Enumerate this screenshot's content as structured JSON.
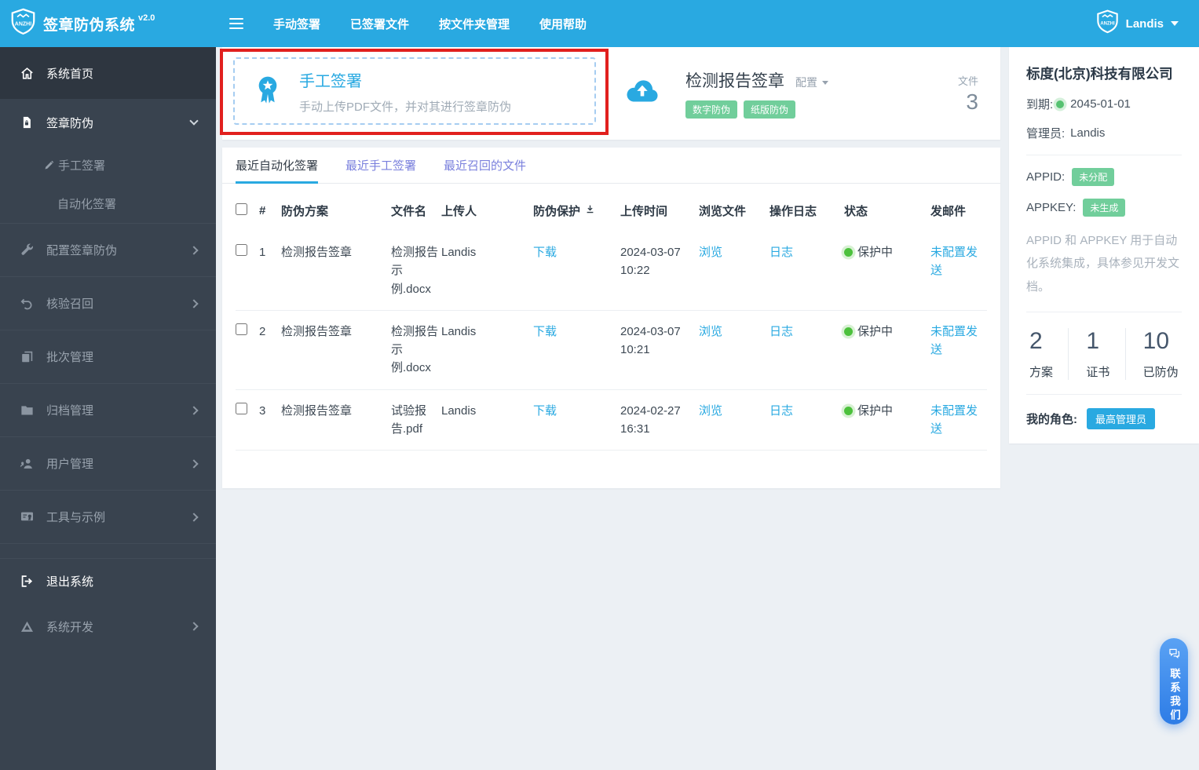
{
  "topbar": {
    "brand": "签章防伪系统",
    "version": "v2.0",
    "nav": [
      {
        "label": "手动签署"
      },
      {
        "label": "已签署文件"
      },
      {
        "label": "按文件夹管理"
      },
      {
        "label": "使用帮助"
      }
    ],
    "user": {
      "name": "Landis"
    }
  },
  "sidebar": {
    "items": [
      {
        "label": "系统首页"
      },
      {
        "label": "签章防伪",
        "expanded": true,
        "children": [
          {
            "label": "手工签署"
          },
          {
            "label": "自动化签署"
          }
        ]
      },
      {
        "label": "配置签章防伪"
      },
      {
        "label": "核验召回"
      },
      {
        "label": "批次管理"
      },
      {
        "label": "归档管理"
      },
      {
        "label": "用户管理"
      },
      {
        "label": "工具与示例"
      },
      {
        "label": "退出系统"
      },
      {
        "label": "系统开发"
      }
    ]
  },
  "quick_actions": {
    "manual_sign": {
      "title": "手工签署",
      "desc": "手动上传PDF文件，并对其进行签章防伪"
    },
    "scheme": {
      "title": "检测报告签章",
      "config_label": "配置",
      "badges": [
        "数字防伪",
        "纸版防伪"
      ],
      "files_label": "文件",
      "files_count": "3"
    }
  },
  "tabs": [
    {
      "label": "最近自动化签署",
      "active": true
    },
    {
      "label": "最近手工签署",
      "active": false
    },
    {
      "label": "最近召回的文件",
      "active": false
    }
  ],
  "table": {
    "headers": [
      "#",
      "防伪方案",
      "文件名",
      "上传人",
      "防伪保护",
      "上传时间",
      "浏览文件",
      "操作日志",
      "状态",
      "发邮件"
    ],
    "rows": [
      {
        "index": "1",
        "scheme": "检测报告签章",
        "file": "检测报告示例.docx",
        "uploader": "Landis",
        "protect": "下载",
        "time": "2024-03-07 10:22",
        "view": "浏览",
        "log": "日志",
        "status": "保护中",
        "mail": "未配置发送"
      },
      {
        "index": "2",
        "scheme": "检测报告签章",
        "file": "检测报告示例.docx",
        "uploader": "Landis",
        "protect": "下载",
        "time": "2024-03-07 10:21",
        "view": "浏览",
        "log": "日志",
        "status": "保护中",
        "mail": "未配置发送"
      },
      {
        "index": "3",
        "scheme": "检测报告签章",
        "file": "试验报告.pdf",
        "uploader": "Landis",
        "protect": "下载",
        "time": "2024-02-27 16:31",
        "view": "浏览",
        "log": "日志",
        "status": "保护中",
        "mail": "未配置发送"
      }
    ]
  },
  "panel": {
    "company": "标度(北京)科技有限公司",
    "expire_label": "到期:",
    "expire_date": "2045-01-01",
    "admin_label": "管理员:",
    "admin_name": "Landis",
    "appid_label": "APPID:",
    "appid_badge": "未分配",
    "appkey_label": "APPKEY:",
    "appkey_badge": "未生成",
    "note": "APPID 和 APPKEY 用于自动化系统集成，具体参见开发文档。",
    "stats": [
      {
        "value": "2",
        "label": "方案"
      },
      {
        "value": "1",
        "label": "证书"
      },
      {
        "value": "10",
        "label": "已防伪"
      }
    ],
    "role_label": "我的角色:",
    "role_badge": "最高管理员"
  },
  "contact": {
    "label": "联系我们"
  },
  "icons": {
    "menu": "hamburger-bars",
    "user_caret": "chevron-down",
    "config_caret": "caret-down",
    "group_caret": "chevron-down",
    "section_caret": "chevron-right",
    "protect_sort": "download-arrow",
    "status_dot": "green-dot",
    "award": "ribbon-badge",
    "upload": "cloud-upload",
    "contact": "chat-bubbles"
  },
  "colors": {
    "accent_blue": "#29a9e1",
    "tab_inactive": "#7a80dd",
    "badge_green": "#71ce9b",
    "status_green": "#4cc13c",
    "annotation_red": "#e1201e",
    "sidebar_bg": "#39434f",
    "contact_gradient": [
      "#5aa2f4",
      "#2d7ce6"
    ]
  }
}
